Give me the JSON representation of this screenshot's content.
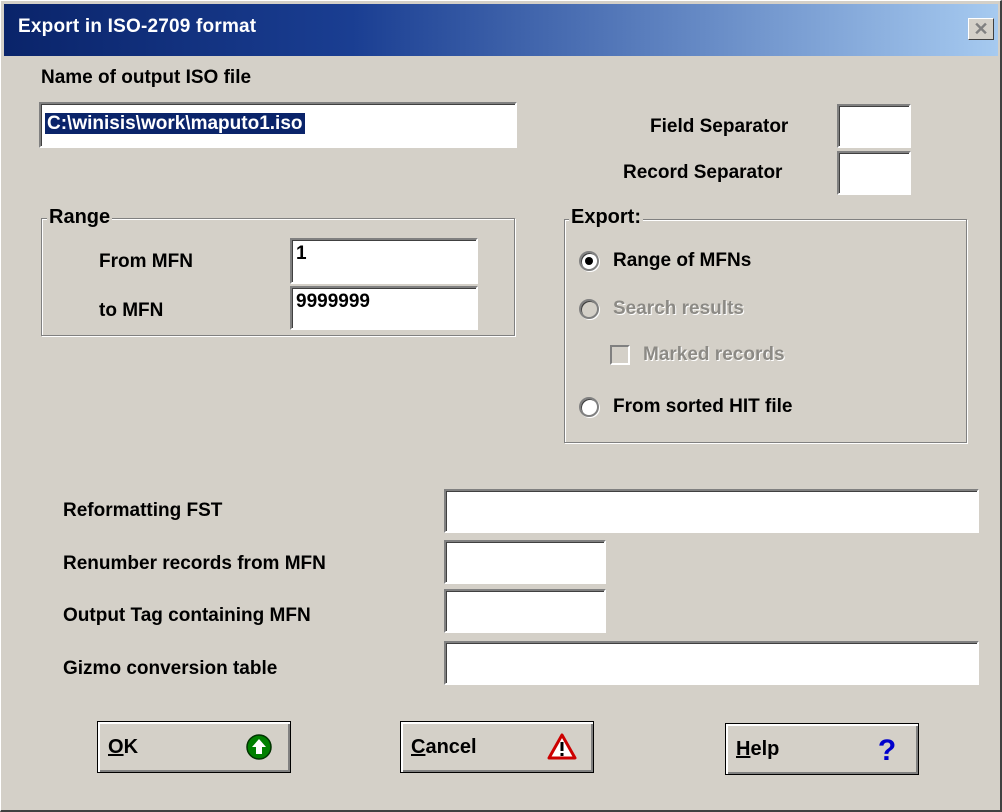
{
  "window": {
    "title": "Export in ISO-2709 format",
    "close_glyph": "✕"
  },
  "output_file": {
    "label": "Name of output ISO file",
    "value": "C:\\winisis\\work\\maputo1.iso"
  },
  "separators": {
    "field_label": "Field Separator",
    "field_value": "",
    "record_label": "Record Separator",
    "record_value": ""
  },
  "range": {
    "legend": "Range",
    "from_label": "From MFN",
    "from_value": "1",
    "to_label": "to MFN",
    "to_value": "9999999"
  },
  "export": {
    "legend": "Export:",
    "options": [
      {
        "label": "Range of MFNs",
        "checked": true,
        "enabled": true
      },
      {
        "label": "Search results",
        "checked": false,
        "enabled": false
      },
      {
        "label": "From sorted HIT file",
        "checked": false,
        "enabled": true
      }
    ],
    "marked_records": {
      "label": "Marked records",
      "checked": false,
      "enabled": false
    }
  },
  "reformatting": {
    "fst_label": "Reformatting FST",
    "fst_value": "",
    "renumber_label": "Renumber records from MFN",
    "renumber_value": "",
    "tag_label": "Output Tag containing MFN",
    "tag_value": "",
    "gizmo_label": "Gizmo conversion table",
    "gizmo_value": ""
  },
  "buttons": {
    "ok": {
      "mnemonic": "O",
      "rest": "K",
      "icon": "ok-arrow-icon",
      "icon_color": "#008000"
    },
    "cancel": {
      "mnemonic": "C",
      "rest": "ancel",
      "icon": "warning-icon",
      "icon_color": "#cc0000"
    },
    "help": {
      "mnemonic": "H",
      "rest": "elp",
      "icon": "help-question-icon",
      "icon_color": "#0000cc"
    }
  }
}
